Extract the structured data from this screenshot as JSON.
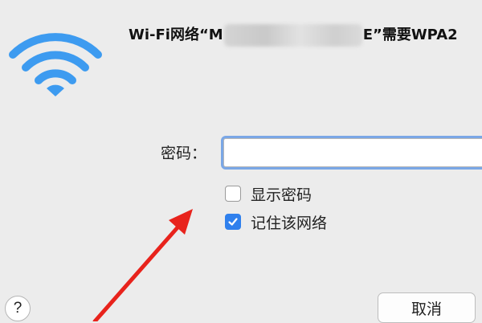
{
  "dialog": {
    "title_prefix": "Wi-Fi网络“M",
    "title_suffix": "E”需要WPA2",
    "password_label": "密码：",
    "password_value": "",
    "show_password_label": "显示密码",
    "show_password_checked": false,
    "remember_network_label": "记住该网络",
    "remember_network_checked": true,
    "help_label": "?",
    "cancel_label": "取消"
  },
  "icons": {
    "wifi": "wifi-icon",
    "checkmark": "checkmark-icon"
  },
  "colors": {
    "wifi_blue": "#3d9bf0",
    "checkbox_blue": "#2f80ed",
    "focus_ring": "#7aa7e6",
    "annotation_arrow": "#e8231c"
  }
}
